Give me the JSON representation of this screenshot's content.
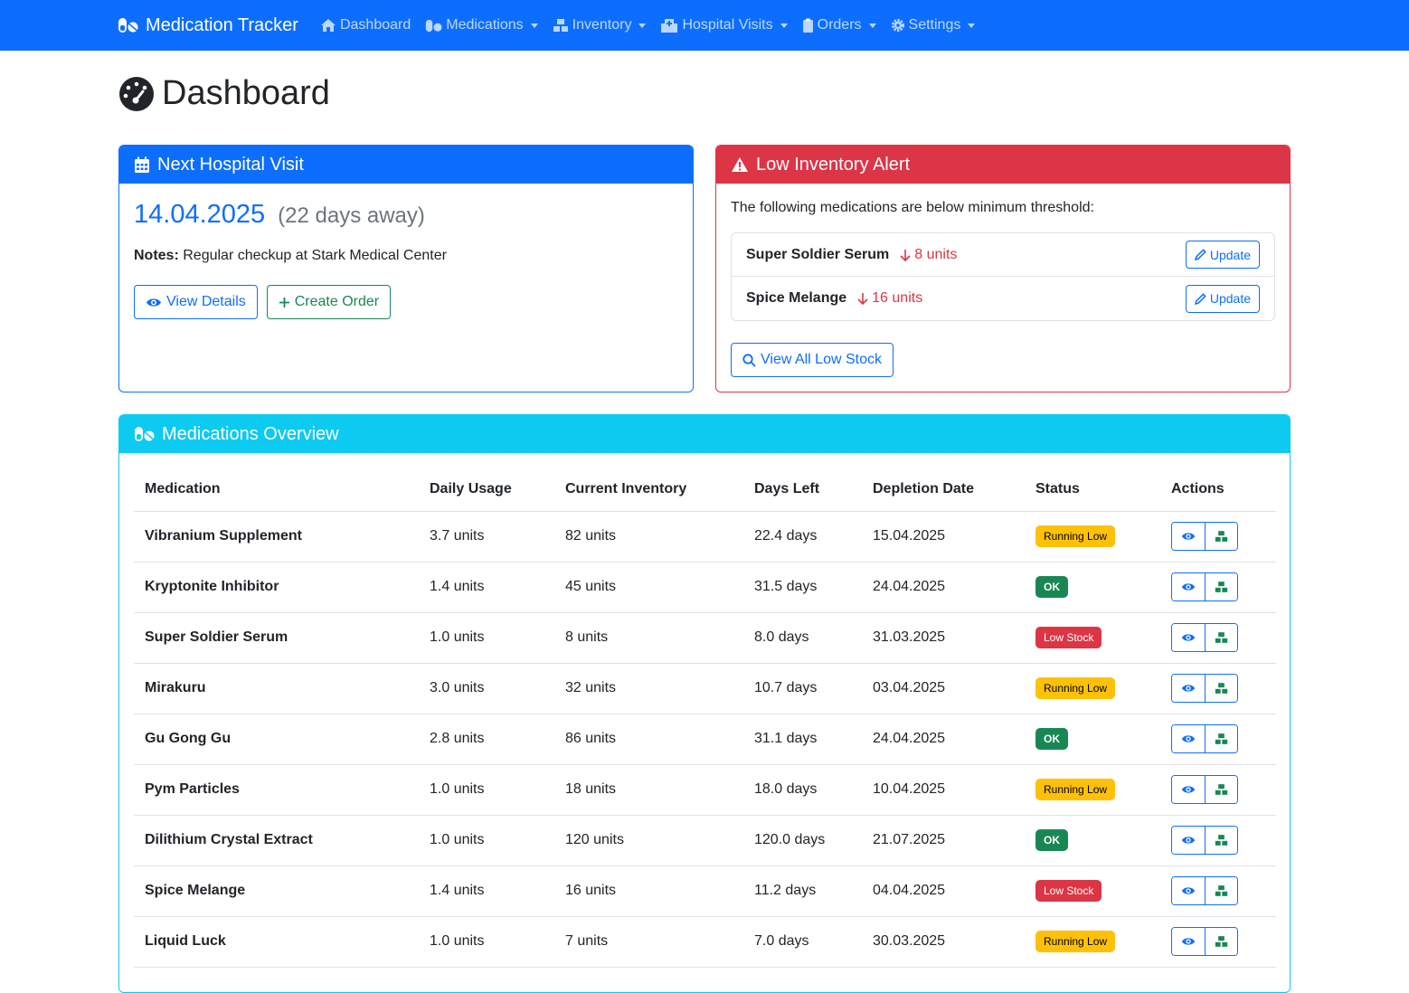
{
  "nav": {
    "brand": "Medication Tracker",
    "items": [
      {
        "label": "Dashboard",
        "icon": "home-icon",
        "dropdown": false
      },
      {
        "label": "Medications",
        "icon": "pills-icon",
        "dropdown": true
      },
      {
        "label": "Inventory",
        "icon": "boxes-icon",
        "dropdown": true
      },
      {
        "label": "Hospital Visits",
        "icon": "hospital-icon",
        "dropdown": true
      },
      {
        "label": "Orders",
        "icon": "clipboard-icon",
        "dropdown": true
      },
      {
        "label": "Settings",
        "icon": "gear-icon",
        "dropdown": true
      }
    ]
  },
  "page": {
    "title": "Dashboard"
  },
  "visit": {
    "header": "Next Hospital Visit",
    "date": "14.04.2025",
    "away": "(22 days away)",
    "notes_label": "Notes:",
    "notes": "Regular checkup at Stark Medical Center",
    "view_details": "View Details",
    "create_order": "Create Order"
  },
  "alert": {
    "header": "Low Inventory Alert",
    "text": "The following medications are below minimum threshold:",
    "items": [
      {
        "name": "Super Soldier Serum",
        "qty": "8 units",
        "button": "Update"
      },
      {
        "name": "Spice Melange",
        "qty": "16 units",
        "button": "Update"
      }
    ],
    "view_all": "View All Low Stock"
  },
  "meds": {
    "header": "Medications Overview",
    "columns": [
      "Medication",
      "Daily Usage",
      "Current Inventory",
      "Days Left",
      "Depletion Date",
      "Status",
      "Actions"
    ],
    "rows": [
      {
        "name": "Vibranium Supplement",
        "daily": "3.7 units",
        "inventory": "82 units",
        "days": "22.4 days",
        "depletion": "15.04.2025",
        "status": "Running Low",
        "status_type": "warning"
      },
      {
        "name": "Kryptonite Inhibitor",
        "daily": "1.4 units",
        "inventory": "45 units",
        "days": "31.5 days",
        "depletion": "24.04.2025",
        "status": "OK",
        "status_type": "success"
      },
      {
        "name": "Super Soldier Serum",
        "daily": "1.0 units",
        "inventory": "8 units",
        "days": "8.0 days",
        "depletion": "31.03.2025",
        "status": "Low Stock",
        "status_type": "danger"
      },
      {
        "name": "Mirakuru",
        "daily": "3.0 units",
        "inventory": "32 units",
        "days": "10.7 days",
        "depletion": "03.04.2025",
        "status": "Running Low",
        "status_type": "warning"
      },
      {
        "name": "Gu Gong Gu",
        "daily": "2.8 units",
        "inventory": "86 units",
        "days": "31.1 days",
        "depletion": "24.04.2025",
        "status": "OK",
        "status_type": "success"
      },
      {
        "name": "Pym Particles",
        "daily": "1.0 units",
        "inventory": "18 units",
        "days": "18.0 days",
        "depletion": "10.04.2025",
        "status": "Running Low",
        "status_type": "warning"
      },
      {
        "name": "Dilithium Crystal Extract",
        "daily": "1.0 units",
        "inventory": "120 units",
        "days": "120.0 days",
        "depletion": "21.07.2025",
        "status": "OK",
        "status_type": "success"
      },
      {
        "name": "Spice Melange",
        "daily": "1.4 units",
        "inventory": "16 units",
        "days": "11.2 days",
        "depletion": "04.04.2025",
        "status": "Low Stock",
        "status_type": "danger"
      },
      {
        "name": "Liquid Luck",
        "daily": "1.0 units",
        "inventory": "7 units",
        "days": "7.0 days",
        "depletion": "30.03.2025",
        "status": "Running Low",
        "status_type": "warning"
      }
    ]
  },
  "colors": {
    "primary": "#0d6efd",
    "danger": "#dc3545",
    "info": "#0dcaf0",
    "success": "#198754",
    "warning": "#ffc107"
  }
}
